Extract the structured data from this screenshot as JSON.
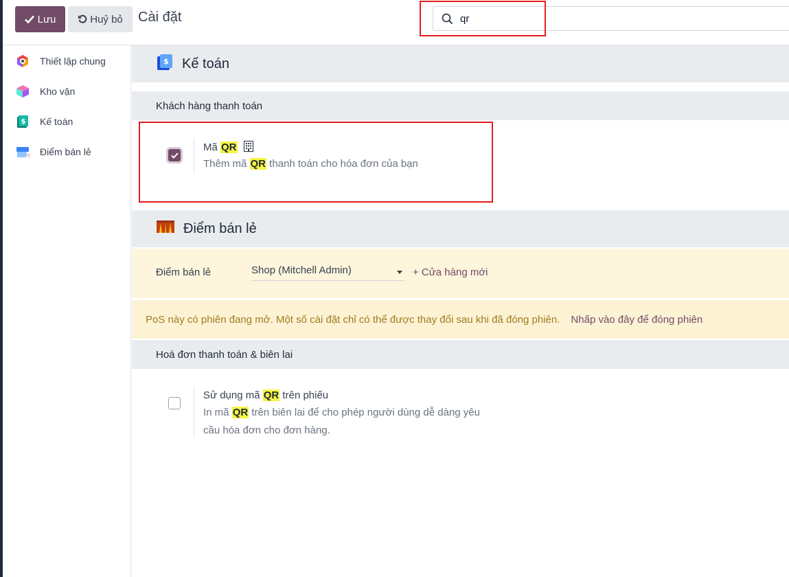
{
  "toolbar": {
    "save_label": "Lưu",
    "cancel_label": "Huỷ bỏ",
    "page_title": "Cài đặt",
    "search_value": "qr"
  },
  "sidebar": {
    "items": [
      {
        "label": "Thiết lập chung",
        "icon": "general-settings-icon"
      },
      {
        "label": "Kho vận",
        "icon": "inventory-icon"
      },
      {
        "label": "Kế toán",
        "icon": "accounting-icon"
      },
      {
        "label": "Điểm bán lẻ",
        "icon": "point-of-sale-icon"
      }
    ]
  },
  "accounting": {
    "header": "Kế toán",
    "section": "Khách hàng thanh toán",
    "qr_setting": {
      "title_prefix": "Mã ",
      "title_highlight": "QR",
      "desc_prefix": "Thêm mã ",
      "desc_highlight": "QR",
      "desc_suffix": " thanh toán cho hóa đơn của bạn",
      "checked": true
    }
  },
  "pos": {
    "header": "Điểm bán lẻ",
    "pos_label": "Điểm bán lẻ",
    "pos_selected": "Shop (Mitchell Admin)",
    "new_shop_label": "+ Cửa hàng mới",
    "notice_text": "PoS này có phiên đang mở. Một số cài đặt chỉ có thể được thay đổi sau khi đã đóng phiên.",
    "notice_link": "Nhấp vào đây để đóng phiên",
    "section": "Hoá đơn thanh toán & biên lai",
    "qr_receipt": {
      "title_prefix": "Sử dụng mã ",
      "title_highlight": "QR",
      "title_suffix": " trên phiếu",
      "desc_line1_prefix": "In mã ",
      "desc_line1_highlight": "QR",
      "desc_line1_suffix": " trên biên lai để cho phép người dùng dễ dàng yêu",
      "desc_line2": "cầu hóa đơn cho đơn hàng.",
      "checked": false
    }
  },
  "colors": {
    "brand": "#714b67",
    "highlight": "#f5f542",
    "annotation": "#e11d1d",
    "notice_bg": "#fcf3d5"
  }
}
